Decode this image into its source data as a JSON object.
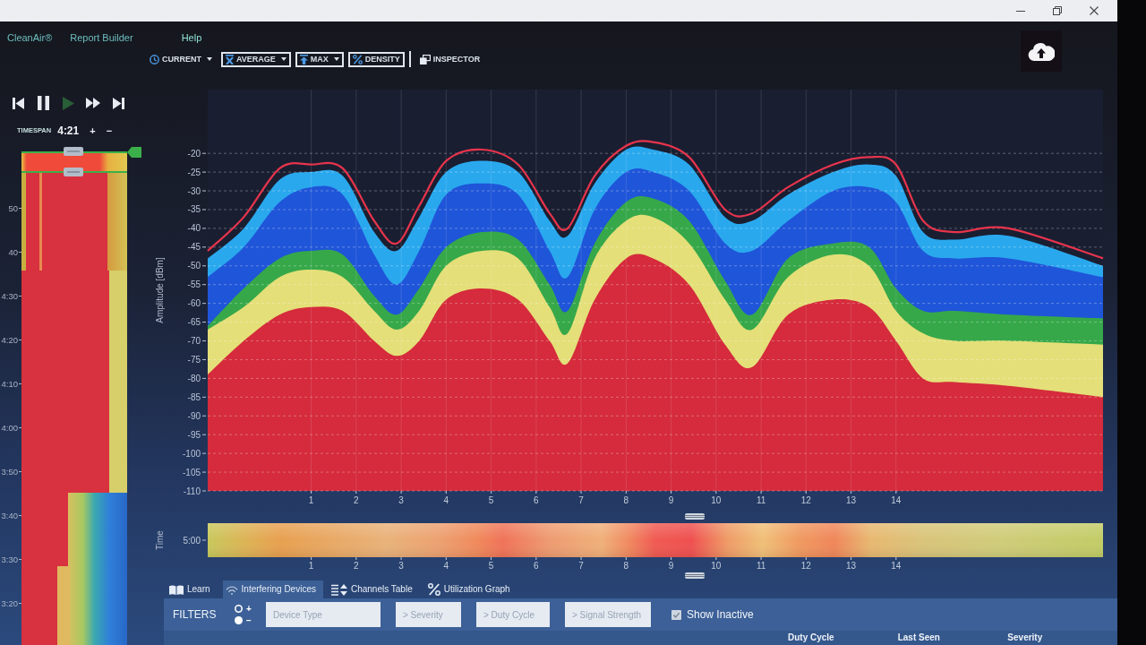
{
  "menu": [
    "CleanAir®",
    "Report Builder",
    "Help"
  ],
  "toolbar": [
    {
      "label": "CURRENT",
      "selected": false,
      "dropdown": true
    },
    {
      "label": "AVERAGE",
      "selected": true,
      "dropdown": true
    },
    {
      "label": "MAX",
      "selected": true,
      "dropdown": true
    },
    {
      "label": "DENSITY",
      "selected": true,
      "dropdown": false
    },
    {
      "label": "INSPECTOR",
      "selected": false,
      "dropdown": false
    }
  ],
  "playback": [
    {
      "disabled": false
    },
    {
      "disabled": false
    },
    {
      "disabled": true
    },
    {
      "disabled": false
    },
    {
      "disabled": false
    }
  ],
  "timespan": {
    "label": "TIMESPAN",
    "value": "4:21",
    "buttons": [
      "+",
      "−"
    ]
  },
  "waterfall": {
    "time_labels": [
      "50",
      "40",
      "4:30",
      "4:20",
      "4:10",
      "4:00",
      "3:50",
      "3:40",
      "3:30",
      "3:20"
    ]
  },
  "spectrum": {
    "chart_data": {
      "type": "line",
      "ylabel": "Amplitude [dBm]",
      "x": [
        -1.3,
        -0.5,
        0.3,
        1,
        1.7,
        2.4,
        2.9,
        3.4,
        4,
        4.8,
        5.6,
        6.3,
        6.7,
        7.3,
        8,
        8.6,
        9.4,
        10.2,
        10.8,
        11.6,
        12.6,
        13.4,
        14,
        14.6,
        15.3,
        16.5,
        18.6
      ],
      "series": [
        {
          "color": "#e8344c",
          "values": [
            -46,
            -37,
            -24,
            -23,
            -24,
            -38,
            -44,
            -34,
            -22,
            -19,
            -23,
            -36,
            -40,
            -26,
            -18,
            -17,
            -21,
            -35,
            -36,
            -29,
            -23,
            -21,
            -23,
            -38,
            -41,
            -40,
            -48
          ]
        }
      ],
      "xlim": [
        -1.3,
        18.6
      ],
      "ylim": [
        -110,
        -3
      ],
      "xticks": [
        1,
        2,
        3,
        4,
        5,
        6,
        7,
        8,
        9,
        10,
        11,
        12,
        13,
        14
      ],
      "yticks": [
        -20,
        -25,
        -30,
        -35,
        -40,
        -45,
        -50,
        -55,
        -60,
        -65,
        -70,
        -75,
        -80,
        -85,
        -90,
        -95,
        -100,
        -105,
        -110
      ],
      "grid": true
    }
  },
  "time_strip": {
    "label": "Time",
    "tick": "5:00",
    "x_labels": [
      "1",
      "2",
      "3",
      "4",
      "5",
      "6",
      "7",
      "8",
      "9",
      "10",
      "11",
      "12",
      "13",
      "14"
    ]
  },
  "tabs": [
    {
      "label": "Learn",
      "selected": false
    },
    {
      "label": "Interfering Devices",
      "selected": true
    },
    {
      "label": "Channels Table",
      "selected": false
    },
    {
      "label": "Utilization Graph",
      "selected": false
    }
  ],
  "filters": {
    "label": "FILTERS",
    "radios": [
      {
        "label": "+",
        "selected": false
      },
      {
        "label": "−",
        "selected": true
      }
    ],
    "fields": [
      {
        "placeholder": "Device Type"
      },
      {
        "placeholder": "> Severity"
      },
      {
        "placeholder": "> Duty Cycle"
      },
      {
        "placeholder": "> Signal Strength"
      }
    ],
    "show_inactive": {
      "label": "Show Inactive",
      "checked": true
    }
  },
  "table": {
    "columns": [
      "Duty Cycle",
      "Last Seen",
      "Severity"
    ]
  }
}
